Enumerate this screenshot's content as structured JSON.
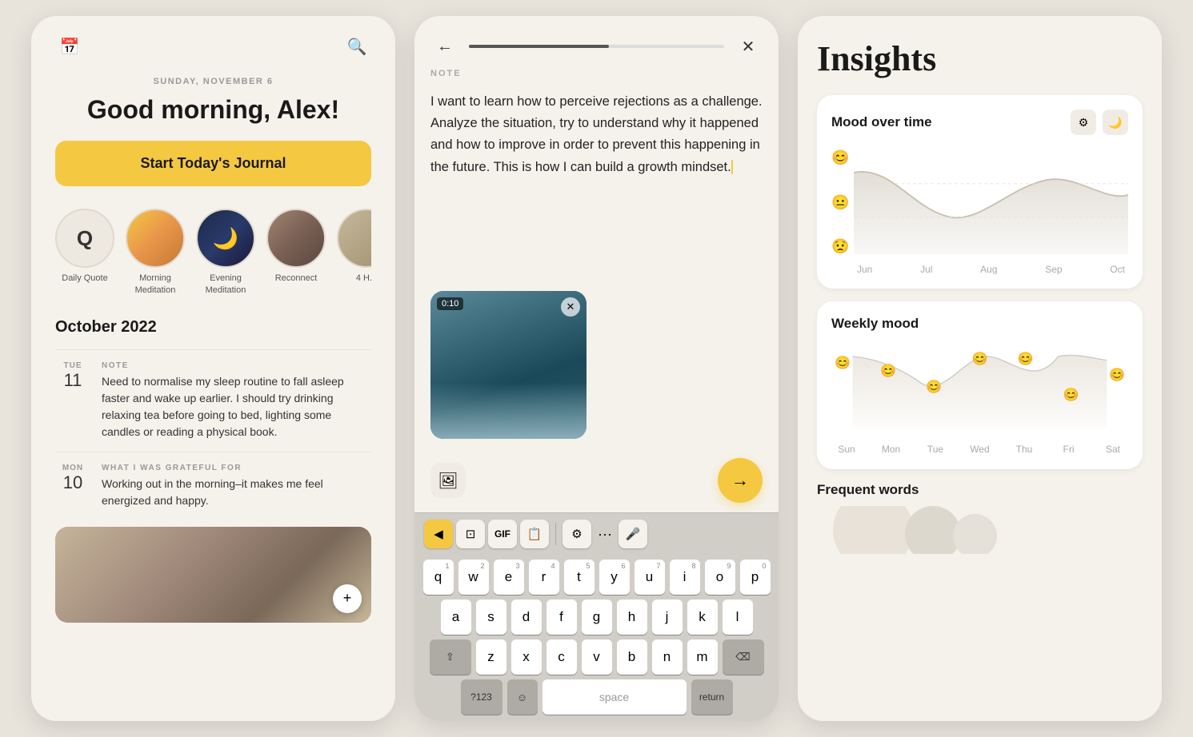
{
  "panel1": {
    "date": "SUNDAY, NOVEMBER 6",
    "greeting": "Good morning, Alex!",
    "start_btn": "Start Today's Journal",
    "stories": [
      {
        "id": "daily-quote",
        "label": "Daily Quote",
        "type": "letter",
        "letter": "Q"
      },
      {
        "id": "morning-meditation",
        "label": "Morning Meditation",
        "type": "sunrise"
      },
      {
        "id": "evening-meditation",
        "label": "Evening Meditation",
        "type": "moon"
      },
      {
        "id": "reconnect",
        "label": "Reconnect",
        "type": "door"
      },
      {
        "id": "four-h",
        "label": "4 H...",
        "type": "last"
      }
    ],
    "section_title": "October 2022",
    "entries": [
      {
        "day_name": "TUE",
        "day_num": "11",
        "type": "NOTE",
        "text": "Need to normalise my sleep routine to fall asleep faster and wake up earlier. I should try drinking relaxing tea before going to bed, lighting some candles or reading a physical book."
      },
      {
        "day_name": "MON",
        "day_num": "10",
        "type": "WHAT I WAS GRATEFUL FOR",
        "text": "Working out in the morning–it makes me feel energized and happy."
      }
    ],
    "add_btn": "+"
  },
  "panel2": {
    "note_label": "NOTE",
    "note_text": "I want to learn how to perceive rejections as a challenge. Analyze the situation, try to understand why it happened and how to improve in order to prevent this happening in the future. This is how I can build a growth mindset.",
    "video_timer": "0:10",
    "keyboard": {
      "rows": [
        [
          "q",
          "w",
          "e",
          "r",
          "t",
          "y",
          "u",
          "i",
          "o",
          "p"
        ],
        [
          "a",
          "s",
          "d",
          "f",
          "g",
          "h",
          "j",
          "k",
          "l"
        ],
        [
          "z",
          "x",
          "c",
          "v",
          "b",
          "n",
          "m"
        ]
      ],
      "numbers": [
        "1",
        "2",
        "3",
        "4",
        "5",
        "6",
        "7",
        "8",
        "9",
        "0"
      ],
      "special_left": "?123",
      "special_right": "return"
    }
  },
  "panel3": {
    "title": "Insights",
    "mood_over_time": {
      "title": "Mood over time",
      "x_labels": [
        "Jun",
        "Jul",
        "Aug",
        "Sep",
        "Oct"
      ],
      "emoji_levels": [
        "😊",
        "😐",
        "😟"
      ]
    },
    "weekly_mood": {
      "title": "Weekly mood",
      "x_labels": [
        "Sun",
        "Mon",
        "Tue",
        "Wed",
        "Thu",
        "Fri",
        "Sat"
      ],
      "emojis": [
        "😊",
        "😊",
        "😊",
        "😊",
        "😊",
        "😊",
        "😊"
      ],
      "y_positions": [
        10,
        20,
        40,
        10,
        10,
        50,
        30
      ]
    },
    "frequent_words": {
      "title": "Frequent words"
    }
  }
}
